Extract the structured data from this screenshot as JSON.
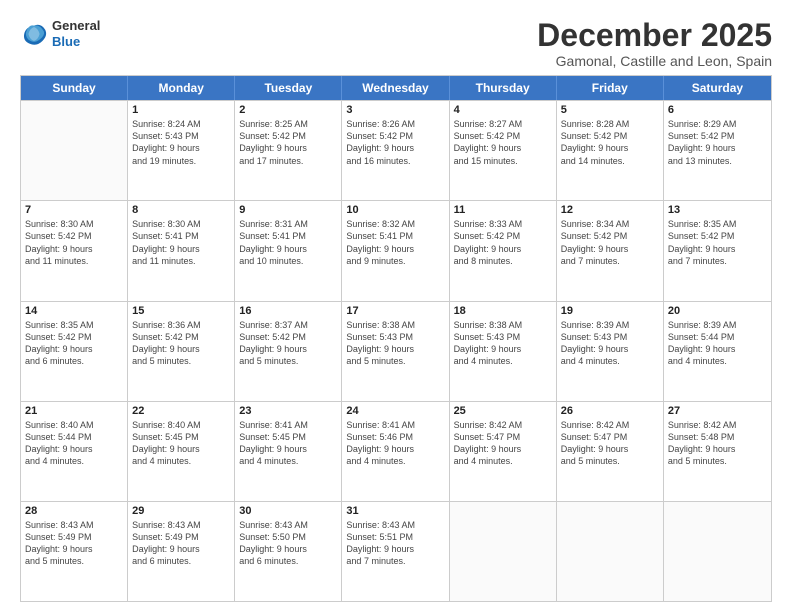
{
  "header": {
    "logo": {
      "general": "General",
      "blue": "Blue"
    },
    "title": "December 2025",
    "subtitle": "Gamonal, Castille and Leon, Spain"
  },
  "days": [
    "Sunday",
    "Monday",
    "Tuesday",
    "Wednesday",
    "Thursday",
    "Friday",
    "Saturday"
  ],
  "weeks": [
    [
      {
        "day": "",
        "content": ""
      },
      {
        "day": "1",
        "content": "Sunrise: 8:24 AM\nSunset: 5:43 PM\nDaylight: 9 hours\nand 19 minutes."
      },
      {
        "day": "2",
        "content": "Sunrise: 8:25 AM\nSunset: 5:42 PM\nDaylight: 9 hours\nand 17 minutes."
      },
      {
        "day": "3",
        "content": "Sunrise: 8:26 AM\nSunset: 5:42 PM\nDaylight: 9 hours\nand 16 minutes."
      },
      {
        "day": "4",
        "content": "Sunrise: 8:27 AM\nSunset: 5:42 PM\nDaylight: 9 hours\nand 15 minutes."
      },
      {
        "day": "5",
        "content": "Sunrise: 8:28 AM\nSunset: 5:42 PM\nDaylight: 9 hours\nand 14 minutes."
      },
      {
        "day": "6",
        "content": "Sunrise: 8:29 AM\nSunset: 5:42 PM\nDaylight: 9 hours\nand 13 minutes."
      }
    ],
    [
      {
        "day": "7",
        "content": "Sunrise: 8:30 AM\nSunset: 5:42 PM\nDaylight: 9 hours\nand 11 minutes."
      },
      {
        "day": "8",
        "content": "Sunrise: 8:30 AM\nSunset: 5:41 PM\nDaylight: 9 hours\nand 11 minutes."
      },
      {
        "day": "9",
        "content": "Sunrise: 8:31 AM\nSunset: 5:41 PM\nDaylight: 9 hours\nand 10 minutes."
      },
      {
        "day": "10",
        "content": "Sunrise: 8:32 AM\nSunset: 5:41 PM\nDaylight: 9 hours\nand 9 minutes."
      },
      {
        "day": "11",
        "content": "Sunrise: 8:33 AM\nSunset: 5:42 PM\nDaylight: 9 hours\nand 8 minutes."
      },
      {
        "day": "12",
        "content": "Sunrise: 8:34 AM\nSunset: 5:42 PM\nDaylight: 9 hours\nand 7 minutes."
      },
      {
        "day": "13",
        "content": "Sunrise: 8:35 AM\nSunset: 5:42 PM\nDaylight: 9 hours\nand 7 minutes."
      }
    ],
    [
      {
        "day": "14",
        "content": "Sunrise: 8:35 AM\nSunset: 5:42 PM\nDaylight: 9 hours\nand 6 minutes."
      },
      {
        "day": "15",
        "content": "Sunrise: 8:36 AM\nSunset: 5:42 PM\nDaylight: 9 hours\nand 5 minutes."
      },
      {
        "day": "16",
        "content": "Sunrise: 8:37 AM\nSunset: 5:42 PM\nDaylight: 9 hours\nand 5 minutes."
      },
      {
        "day": "17",
        "content": "Sunrise: 8:38 AM\nSunset: 5:43 PM\nDaylight: 9 hours\nand 5 minutes."
      },
      {
        "day": "18",
        "content": "Sunrise: 8:38 AM\nSunset: 5:43 PM\nDaylight: 9 hours\nand 4 minutes."
      },
      {
        "day": "19",
        "content": "Sunrise: 8:39 AM\nSunset: 5:43 PM\nDaylight: 9 hours\nand 4 minutes."
      },
      {
        "day": "20",
        "content": "Sunrise: 8:39 AM\nSunset: 5:44 PM\nDaylight: 9 hours\nand 4 minutes."
      }
    ],
    [
      {
        "day": "21",
        "content": "Sunrise: 8:40 AM\nSunset: 5:44 PM\nDaylight: 9 hours\nand 4 minutes."
      },
      {
        "day": "22",
        "content": "Sunrise: 8:40 AM\nSunset: 5:45 PM\nDaylight: 9 hours\nand 4 minutes."
      },
      {
        "day": "23",
        "content": "Sunrise: 8:41 AM\nSunset: 5:45 PM\nDaylight: 9 hours\nand 4 minutes."
      },
      {
        "day": "24",
        "content": "Sunrise: 8:41 AM\nSunset: 5:46 PM\nDaylight: 9 hours\nand 4 minutes."
      },
      {
        "day": "25",
        "content": "Sunrise: 8:42 AM\nSunset: 5:47 PM\nDaylight: 9 hours\nand 4 minutes."
      },
      {
        "day": "26",
        "content": "Sunrise: 8:42 AM\nSunset: 5:47 PM\nDaylight: 9 hours\nand 5 minutes."
      },
      {
        "day": "27",
        "content": "Sunrise: 8:42 AM\nSunset: 5:48 PM\nDaylight: 9 hours\nand 5 minutes."
      }
    ],
    [
      {
        "day": "28",
        "content": "Sunrise: 8:43 AM\nSunset: 5:49 PM\nDaylight: 9 hours\nand 5 minutes."
      },
      {
        "day": "29",
        "content": "Sunrise: 8:43 AM\nSunset: 5:49 PM\nDaylight: 9 hours\nand 6 minutes."
      },
      {
        "day": "30",
        "content": "Sunrise: 8:43 AM\nSunset: 5:50 PM\nDaylight: 9 hours\nand 6 minutes."
      },
      {
        "day": "31",
        "content": "Sunrise: 8:43 AM\nSunset: 5:51 PM\nDaylight: 9 hours\nand 7 minutes."
      },
      {
        "day": "",
        "content": ""
      },
      {
        "day": "",
        "content": ""
      },
      {
        "day": "",
        "content": ""
      }
    ]
  ]
}
